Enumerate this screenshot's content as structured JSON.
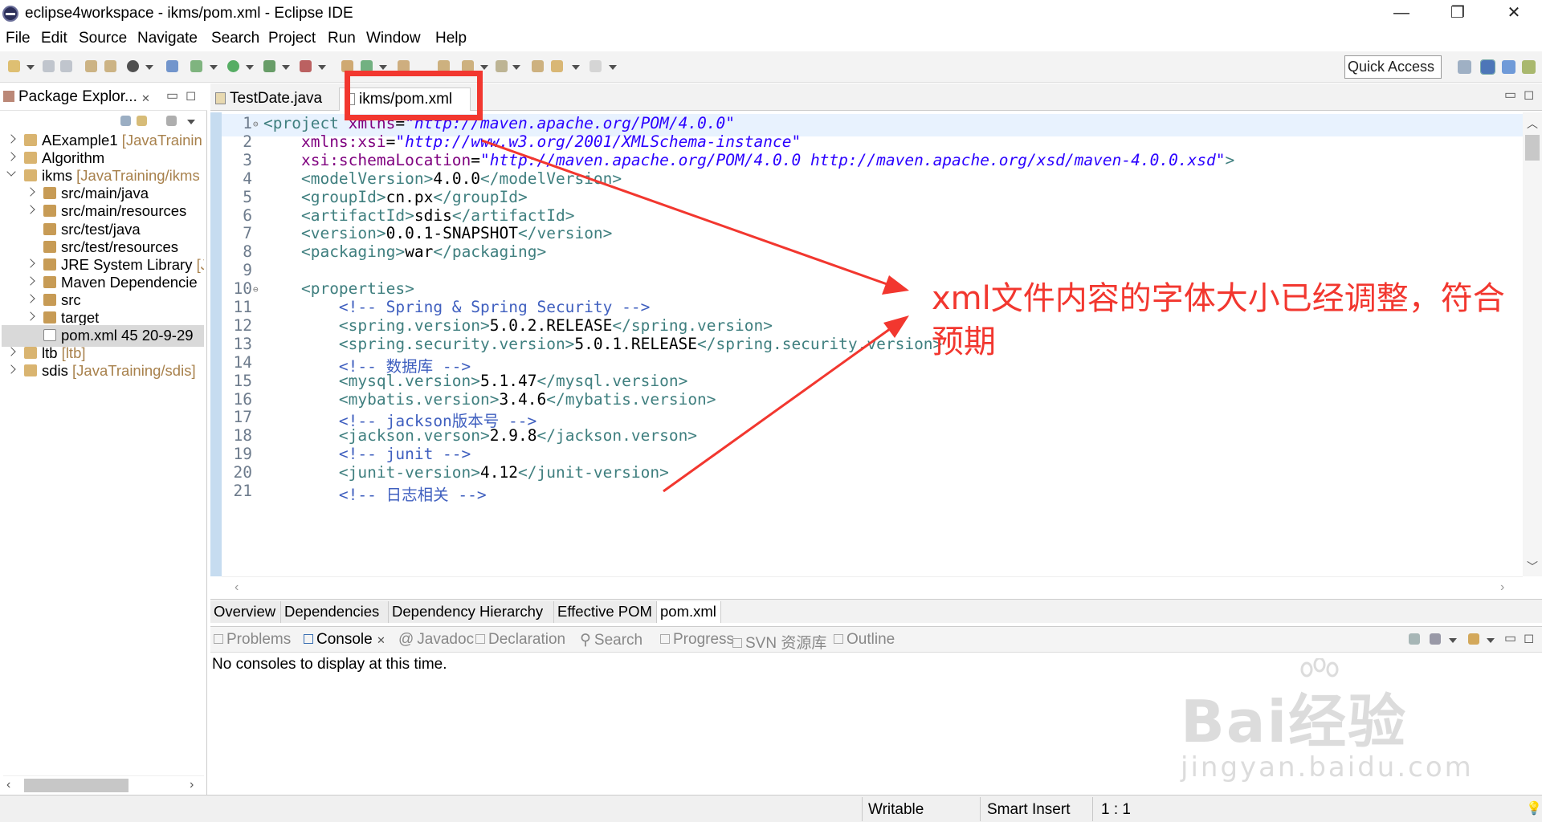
{
  "window": {
    "title": "eclipse4workspace - ikms/pom.xml - Eclipse IDE",
    "minimize": "—",
    "maximize": "❐",
    "close": "✕"
  },
  "menu": [
    "File",
    "Edit",
    "Source",
    "Navigate",
    "Search",
    "Project",
    "Run",
    "Window",
    "Help"
  ],
  "toolbar": {
    "quick_access": "Quick Access"
  },
  "package_explorer": {
    "title": "Package Explor...",
    "items": [
      {
        "name": "AExample1",
        "decoration": " [JavaTrainin",
        "level": 0,
        "expanded": false
      },
      {
        "name": "Algorithm",
        "decoration": "",
        "level": 0,
        "expanded": false
      },
      {
        "name": "ikms",
        "decoration": " [JavaTraining/ikms",
        "level": 0,
        "expanded": true
      },
      {
        "name": "src/main/java",
        "decoration": "",
        "level": 1,
        "expanded": false
      },
      {
        "name": "src/main/resources",
        "decoration": "",
        "level": 1,
        "expanded": false
      },
      {
        "name": "src/test/java",
        "decoration": "",
        "level": 1,
        "expanded": null
      },
      {
        "name": "src/test/resources",
        "decoration": "",
        "level": 1,
        "expanded": null
      },
      {
        "name": "JRE System Library",
        "decoration": " [J",
        "level": 1,
        "expanded": false
      },
      {
        "name": "Maven Dependencie",
        "decoration": "",
        "level": 1,
        "expanded": false
      },
      {
        "name": "src",
        "decoration": "",
        "level": 1,
        "expanded": false
      },
      {
        "name": "target",
        "decoration": "",
        "level": 1,
        "expanded": false
      },
      {
        "name": "pom.xml 45  20-9-29",
        "decoration": "",
        "level": 1,
        "expanded": null
      },
      {
        "name": "ltb",
        "decoration": " [ltb]",
        "level": 0,
        "expanded": false
      },
      {
        "name": "sdis",
        "decoration": " [JavaTraining/sdis]",
        "level": 0,
        "expanded": false
      }
    ]
  },
  "editor": {
    "tabs": [
      {
        "label": "TestDate.java"
      },
      {
        "label": "ikms/pom.xml"
      }
    ],
    "code": [
      {
        "n": "1",
        "fold": true,
        "parts": [
          [
            "tag",
            "<project "
          ],
          [
            "attr",
            "xmlns"
          ],
          [
            "txt",
            "="
          ],
          [
            "val",
            "\"http://maven.apache.org/POM/4.0.0\""
          ]
        ]
      },
      {
        "n": "2",
        "parts": [
          [
            "txt",
            "    "
          ],
          [
            "attr",
            "xmlns:xsi"
          ],
          [
            "txt",
            "="
          ],
          [
            "val",
            "\"http://www.w3.org/2001/XMLSchema-instance\""
          ]
        ]
      },
      {
        "n": "3",
        "parts": [
          [
            "txt",
            "    "
          ],
          [
            "attr",
            "xsi:schemaLocation"
          ],
          [
            "txt",
            "="
          ],
          [
            "val",
            "\"http://maven.apache.org/POM/4.0.0 http://maven.apache.org/xsd/maven-4.0.0.xsd\""
          ],
          [
            "tag",
            ">"
          ]
        ]
      },
      {
        "n": "4",
        "parts": [
          [
            "txt",
            "    "
          ],
          [
            "tag",
            "<modelVersion>"
          ],
          [
            "txt",
            "4.0.0"
          ],
          [
            "tag",
            "</modelVersion>"
          ]
        ]
      },
      {
        "n": "5",
        "parts": [
          [
            "txt",
            "    "
          ],
          [
            "tag",
            "<groupId>"
          ],
          [
            "txt",
            "cn.px"
          ],
          [
            "tag",
            "</groupId>"
          ]
        ]
      },
      {
        "n": "6",
        "parts": [
          [
            "txt",
            "    "
          ],
          [
            "tag",
            "<artifactId>"
          ],
          [
            "txt",
            "sdis"
          ],
          [
            "tag",
            "</artifactId>"
          ]
        ]
      },
      {
        "n": "7",
        "parts": [
          [
            "txt",
            "    "
          ],
          [
            "tag",
            "<version>"
          ],
          [
            "txt",
            "0.0.1-SNAPSHOT"
          ],
          [
            "tag",
            "</version>"
          ]
        ]
      },
      {
        "n": "8",
        "parts": [
          [
            "txt",
            "    "
          ],
          [
            "tag",
            "<packaging>"
          ],
          [
            "txt",
            "war"
          ],
          [
            "tag",
            "</packaging>"
          ]
        ]
      },
      {
        "n": "9",
        "parts": []
      },
      {
        "n": "10",
        "fold": true,
        "parts": [
          [
            "txt",
            "    "
          ],
          [
            "tag",
            "<properties>"
          ]
        ]
      },
      {
        "n": "11",
        "parts": [
          [
            "txt",
            "        "
          ],
          [
            "cmt",
            "<!-- Spring & Spring Security -->"
          ]
        ]
      },
      {
        "n": "12",
        "parts": [
          [
            "txt",
            "        "
          ],
          [
            "tag",
            "<spring.version>"
          ],
          [
            "txt",
            "5.0.2.RELEASE"
          ],
          [
            "tag",
            "</spring.version>"
          ]
        ]
      },
      {
        "n": "13",
        "parts": [
          [
            "txt",
            "        "
          ],
          [
            "tag",
            "<spring.security.version>"
          ],
          [
            "txt",
            "5.0.1.RELEASE"
          ],
          [
            "tag",
            "</spring.security.version>"
          ]
        ]
      },
      {
        "n": "14",
        "parts": [
          [
            "txt",
            "        "
          ],
          [
            "cmt",
            "<!-- 数据库 -->"
          ]
        ]
      },
      {
        "n": "15",
        "parts": [
          [
            "txt",
            "        "
          ],
          [
            "tag",
            "<mysql.version>"
          ],
          [
            "txt",
            "5.1.47"
          ],
          [
            "tag",
            "</mysql.version>"
          ]
        ]
      },
      {
        "n": "16",
        "parts": [
          [
            "txt",
            "        "
          ],
          [
            "tag",
            "<mybatis.version>"
          ],
          [
            "txt",
            "3.4.6"
          ],
          [
            "tag",
            "</mybatis.version>"
          ]
        ]
      },
      {
        "n": "17",
        "parts": [
          [
            "txt",
            "        "
          ],
          [
            "cmt",
            "<!-- jackson版本号 -->"
          ]
        ]
      },
      {
        "n": "18",
        "parts": [
          [
            "txt",
            "        "
          ],
          [
            "tag",
            "<jackson.verson>"
          ],
          [
            "txt",
            "2.9.8"
          ],
          [
            "tag",
            "</jackson.verson>"
          ]
        ]
      },
      {
        "n": "19",
        "parts": [
          [
            "txt",
            "        "
          ],
          [
            "cmt",
            "<!-- junit -->"
          ]
        ]
      },
      {
        "n": "20",
        "parts": [
          [
            "txt",
            "        "
          ],
          [
            "tag",
            "<junit-version>"
          ],
          [
            "txt",
            "4.12"
          ],
          [
            "tag",
            "</junit-version>"
          ]
        ]
      },
      {
        "n": "21",
        "parts": [
          [
            "txt",
            "        "
          ],
          [
            "cmt",
            "<!-- 日志相关 -->"
          ]
        ]
      }
    ],
    "bottom_tabs": [
      "Overview",
      "Dependencies",
      "Dependency Hierarchy",
      "Effective POM",
      "pom.xml"
    ]
  },
  "annotation": {
    "text": "xml文件内容的字体大小已经调整，符合预期"
  },
  "console": {
    "tabs": [
      "Problems",
      "Console",
      "Javadoc",
      "Declaration",
      "Search",
      "Progress",
      "SVN 资源库",
      "Outline"
    ],
    "message": "No consoles to display at this time."
  },
  "status": {
    "writable": "Writable",
    "insert": "Smart Insert",
    "position": "1 : 1"
  },
  "watermark": {
    "line1": "Bai经验",
    "line2": "jingyan.baidu.com"
  },
  "colors": {
    "accent_red": "#f2372f",
    "xml_tag": "#3f7f7f",
    "xml_attr": "#7f007f",
    "xml_value": "#2a00ff",
    "xml_comment": "#3f5fbf"
  }
}
